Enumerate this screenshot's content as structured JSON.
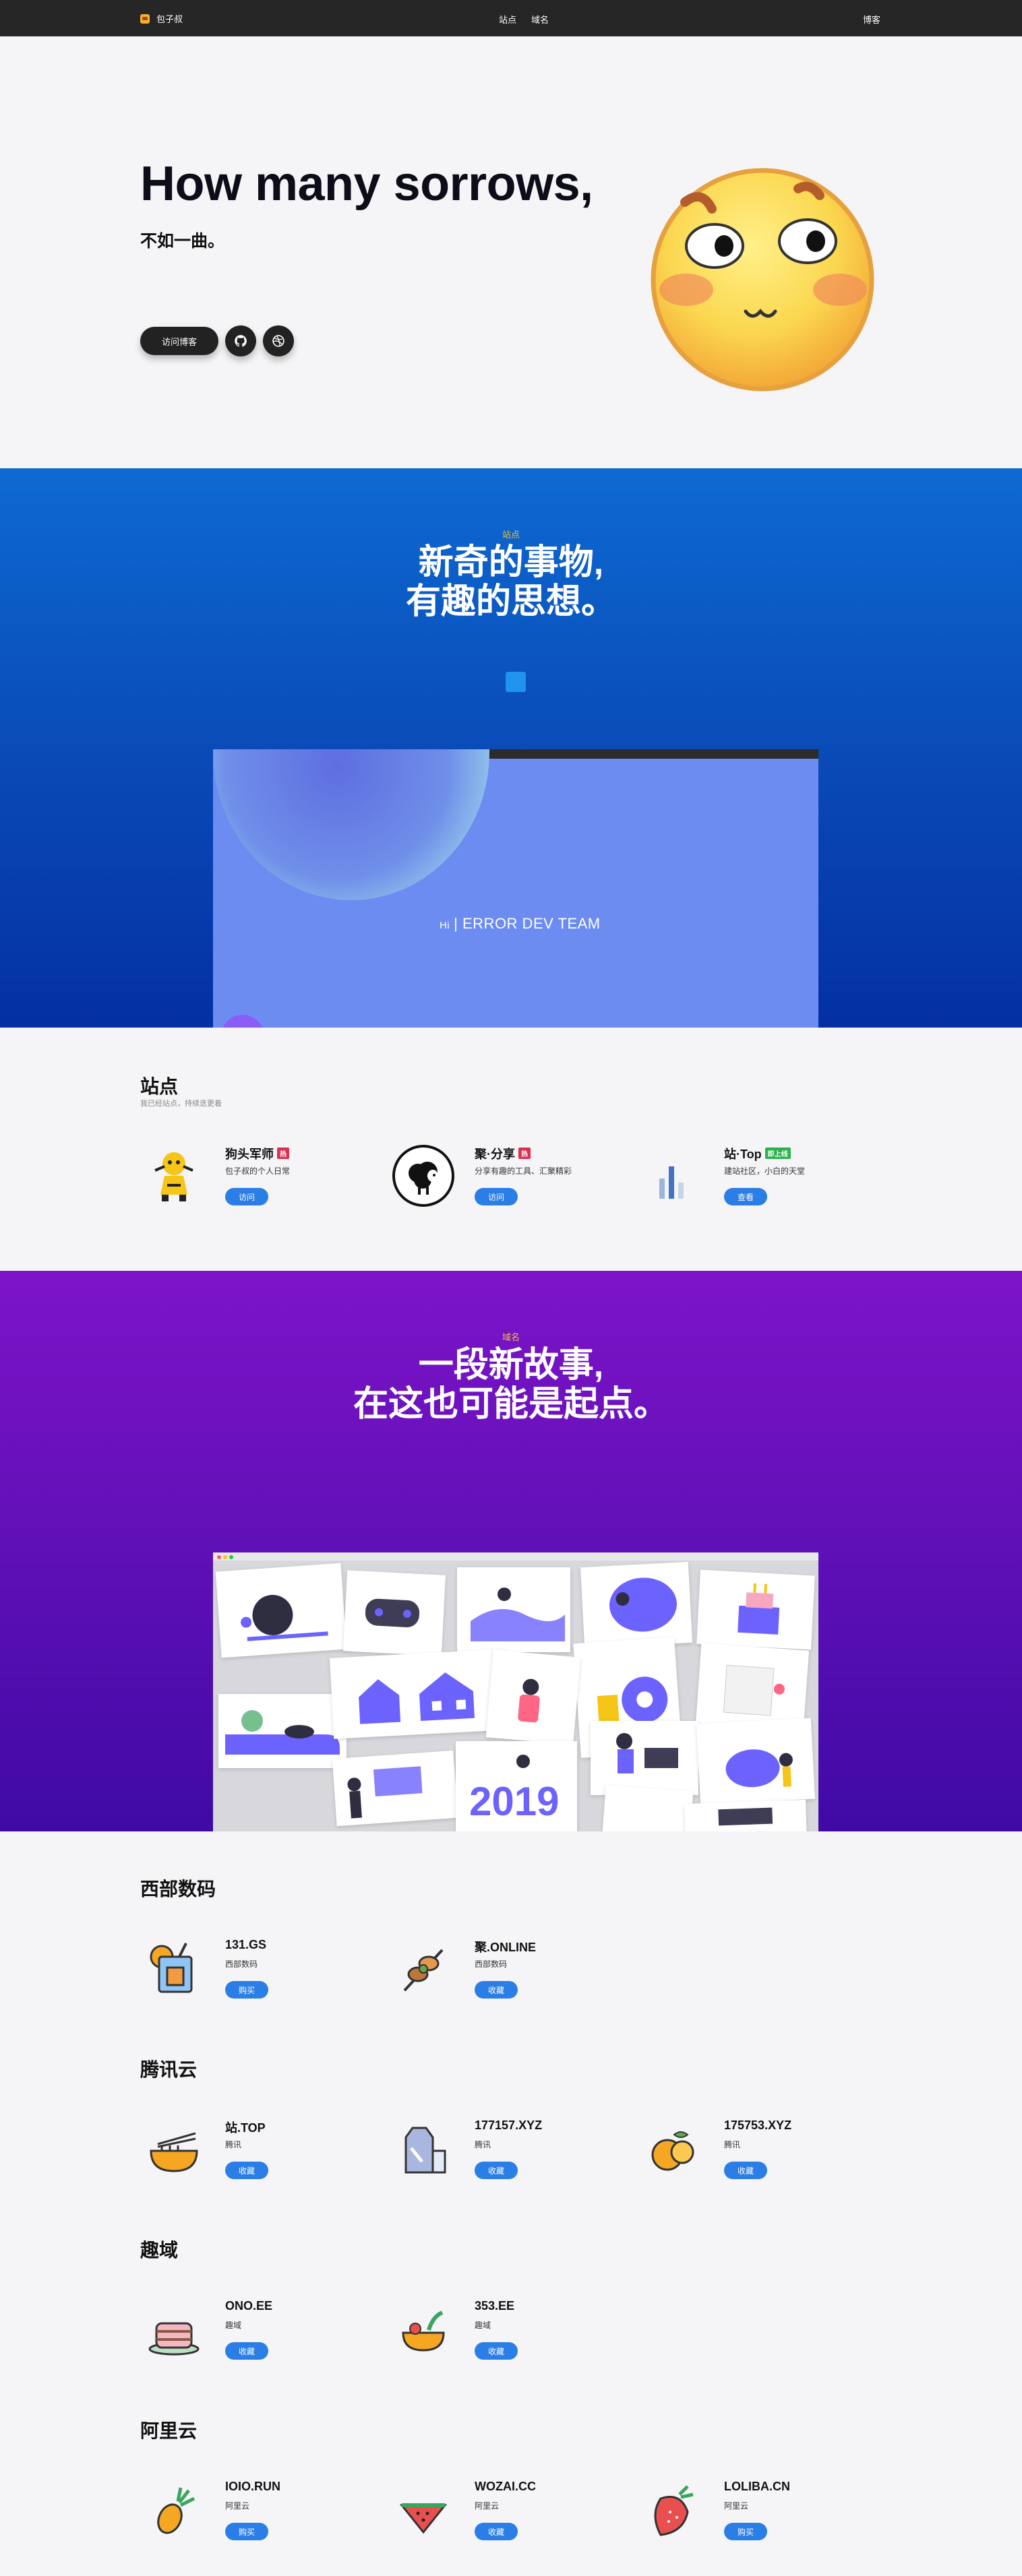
{
  "topbar": {
    "brand": "包子叔",
    "nav": [
      "站点",
      "域名"
    ],
    "right": "博客"
  },
  "hero": {
    "title": "How many sorrows,",
    "subtitle": "不如一曲。",
    "visit_button": "访问博客",
    "icons": [
      "github-icon",
      "dribbble-icon"
    ]
  },
  "sites_banner": {
    "kicker": "站点",
    "title_line1": "新奇的事物,",
    "title_line2": "有趣的思想。",
    "mock": {
      "hi": "Hi",
      "team": "ERROR DEV TEAM"
    }
  },
  "sites": {
    "title": "站点",
    "description": "我已经站点，持续迭更着",
    "items": [
      {
        "title": "狗头军师",
        "badge": "热",
        "badge_color": "#d9304f",
        "text": "包子叔的个人日常",
        "button": "访问"
      },
      {
        "title": "聚·分享",
        "badge": "热",
        "badge_color": "#d9304f",
        "text": "分享有趣的工具、汇聚精彩",
        "button": "访问"
      },
      {
        "title": "站·Top",
        "badge": "即上线",
        "badge_color": "#2bb24c",
        "text": "建站社区，小白的天堂",
        "button": "查看"
      }
    ]
  },
  "domains_banner": {
    "kicker": "域名",
    "title_line1": "一段新故事,",
    "title_line2": "在这也可能是起点。",
    "illus_label": "2019"
  },
  "domains": [
    {
      "title": "西部数码",
      "items": [
        {
          "name": "131.GS",
          "vendor": "西部数码",
          "button": "购买",
          "icon": "drink-icon"
        },
        {
          "name": "聚.ONLINE",
          "vendor": "西部数码",
          "button": "收藏",
          "icon": "skewer-icon"
        }
      ]
    },
    {
      "title": "腾讯云",
      "items": [
        {
          "name": "站.TOP",
          "vendor": "腾讯",
          "button": "收藏",
          "icon": "noodle-bowl-icon"
        },
        {
          "name": "177157.XYZ",
          "vendor": "腾讯",
          "button": "收藏",
          "icon": "milk-icon"
        },
        {
          "name": "175753.XYZ",
          "vendor": "腾讯",
          "button": "收藏",
          "icon": "orange-icon"
        }
      ]
    },
    {
      "title": "趣域",
      "items": [
        {
          "name": "ONO.EE",
          "vendor": "趣域",
          "button": "收藏",
          "icon": "cake-icon"
        },
        {
          "name": "353.EE",
          "vendor": "趣域",
          "button": "收藏",
          "icon": "salad-icon"
        }
      ]
    },
    {
      "title": "阿里云",
      "items": [
        {
          "name": "IOIO.RUN",
          "vendor": "阿里云",
          "button": "购买",
          "icon": "pineapple-icon"
        },
        {
          "name": "WOZAI.CC",
          "vendor": "阿里云",
          "button": "收藏",
          "icon": "watermelon-icon"
        },
        {
          "name": "LOLIBA.CN",
          "vendor": "阿里云",
          "button": "购买",
          "icon": "strawberry-icon"
        }
      ]
    }
  ],
  "colors": {
    "accent": "#2b7ee6",
    "kicker": "#f3c03b"
  }
}
